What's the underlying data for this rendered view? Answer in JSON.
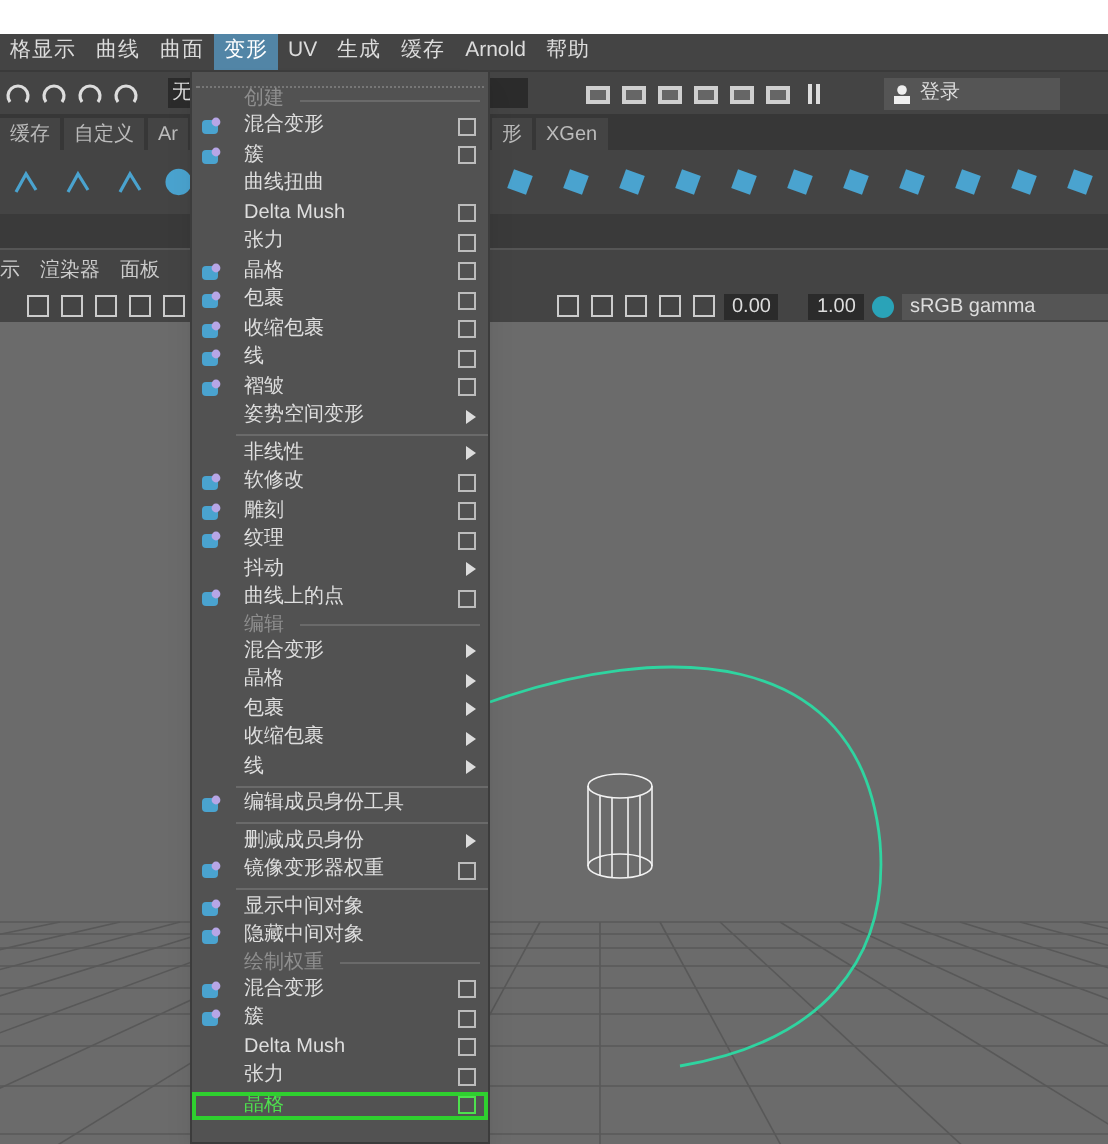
{
  "menu_bar": [
    {
      "label": "格显示",
      "selected": false
    },
    {
      "label": "曲线",
      "selected": false
    },
    {
      "label": "曲面",
      "selected": false
    },
    {
      "label": "变形",
      "selected": true
    },
    {
      "label": "UV",
      "selected": false
    },
    {
      "label": "生成",
      "selected": false
    },
    {
      "label": "缓存",
      "selected": false
    },
    {
      "label": "Arnold",
      "selected": false
    },
    {
      "label": "帮助",
      "selected": false
    }
  ],
  "toolbar": {
    "field_value": "无",
    "login": "登录"
  },
  "shelf_tabs": [
    "缓存",
    "自定义",
    "Ar",
    "形",
    "XGen"
  ],
  "panel_menu": [
    "示",
    "渲染器",
    "面板"
  ],
  "viewport_toolbar": {
    "values": [
      "0.00",
      "1.00"
    ],
    "color_space": "sRGB gamma"
  },
  "dropdown": [
    {
      "kind": "section",
      "label": "创建"
    },
    {
      "kind": "item",
      "label": "混合变形",
      "option_box": true,
      "submenu": false,
      "icon": true,
      "selected": false
    },
    {
      "kind": "item",
      "label": "簇",
      "option_box": true,
      "submenu": false,
      "icon": true,
      "selected": false
    },
    {
      "kind": "item",
      "label": "曲线扭曲",
      "option_box": false,
      "submenu": false,
      "icon": false,
      "selected": false
    },
    {
      "kind": "item",
      "label": "Delta Mush",
      "option_box": true,
      "submenu": false,
      "icon": false,
      "selected": false
    },
    {
      "kind": "item",
      "label": "张力",
      "option_box": true,
      "submenu": false,
      "icon": false,
      "selected": false
    },
    {
      "kind": "item",
      "label": "晶格",
      "option_box": true,
      "submenu": false,
      "icon": true,
      "selected": false
    },
    {
      "kind": "item",
      "label": "包裹",
      "option_box": true,
      "submenu": false,
      "icon": true,
      "selected": false
    },
    {
      "kind": "item",
      "label": "收缩包裹",
      "option_box": true,
      "submenu": false,
      "icon": true,
      "selected": false
    },
    {
      "kind": "item",
      "label": "线",
      "option_box": true,
      "submenu": false,
      "icon": true,
      "selected": false
    },
    {
      "kind": "item",
      "label": "褶皱",
      "option_box": true,
      "submenu": false,
      "icon": true,
      "selected": false
    },
    {
      "kind": "item",
      "label": "姿势空间变形",
      "option_box": false,
      "submenu": true,
      "icon": false,
      "selected": false
    },
    {
      "kind": "item",
      "label": "非线性",
      "option_box": false,
      "submenu": true,
      "icon": false,
      "selected": false,
      "divider_before": true
    },
    {
      "kind": "item",
      "label": "软修改",
      "option_box": true,
      "submenu": false,
      "icon": true,
      "selected": false
    },
    {
      "kind": "item",
      "label": "雕刻",
      "option_box": true,
      "submenu": false,
      "icon": true,
      "selected": false
    },
    {
      "kind": "item",
      "label": "纹理",
      "option_box": true,
      "submenu": false,
      "icon": true,
      "selected": false
    },
    {
      "kind": "item",
      "label": "抖动",
      "option_box": false,
      "submenu": true,
      "icon": false,
      "selected": false
    },
    {
      "kind": "item",
      "label": "曲线上的点",
      "option_box": true,
      "submenu": false,
      "icon": true,
      "selected": false
    },
    {
      "kind": "section",
      "label": "编辑"
    },
    {
      "kind": "item",
      "label": "混合变形",
      "option_box": false,
      "submenu": true,
      "icon": false,
      "selected": false
    },
    {
      "kind": "item",
      "label": "晶格",
      "option_box": false,
      "submenu": true,
      "icon": false,
      "selected": false
    },
    {
      "kind": "item",
      "label": "包裹",
      "option_box": false,
      "submenu": true,
      "icon": false,
      "selected": false
    },
    {
      "kind": "item",
      "label": "收缩包裹",
      "option_box": false,
      "submenu": true,
      "icon": false,
      "selected": false
    },
    {
      "kind": "item",
      "label": "线",
      "option_box": false,
      "submenu": true,
      "icon": false,
      "selected": false
    },
    {
      "kind": "item",
      "label": "编辑成员身份工具",
      "option_box": false,
      "submenu": false,
      "icon": true,
      "selected": false,
      "divider_before": true
    },
    {
      "kind": "item",
      "label": "删减成员身份",
      "option_box": false,
      "submenu": true,
      "icon": false,
      "selected": false,
      "divider_before": true
    },
    {
      "kind": "item",
      "label": "镜像变形器权重",
      "option_box": true,
      "submenu": false,
      "icon": true,
      "selected": false
    },
    {
      "kind": "item",
      "label": "显示中间对象",
      "option_box": false,
      "submenu": false,
      "icon": true,
      "selected": false,
      "divider_before": true
    },
    {
      "kind": "item",
      "label": "隐藏中间对象",
      "option_box": false,
      "submenu": false,
      "icon": true,
      "selected": false
    },
    {
      "kind": "section",
      "label": "绘制权重"
    },
    {
      "kind": "item",
      "label": "混合变形",
      "option_box": true,
      "submenu": false,
      "icon": true,
      "selected": false
    },
    {
      "kind": "item",
      "label": "簇",
      "option_box": true,
      "submenu": false,
      "icon": true,
      "selected": false
    },
    {
      "kind": "item",
      "label": "Delta Mush",
      "option_box": true,
      "submenu": false,
      "icon": false,
      "selected": false
    },
    {
      "kind": "item",
      "label": "张力",
      "option_box": true,
      "submenu": false,
      "icon": false,
      "selected": false
    },
    {
      "kind": "item",
      "label": "晶格",
      "option_box": true,
      "submenu": false,
      "icon": false,
      "selected": true
    }
  ]
}
